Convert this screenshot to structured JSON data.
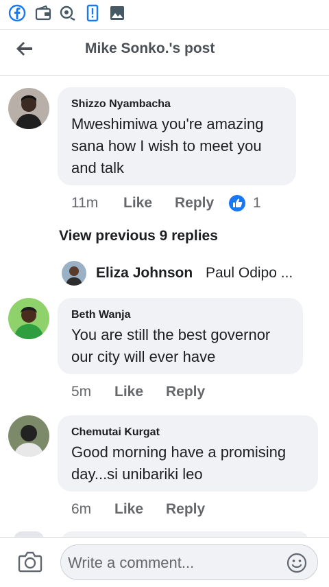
{
  "header": {
    "title": "Mike Sonko.'s post"
  },
  "comments": [
    {
      "author": "Shizzo Nyambacha",
      "lines": [
        "Mweshimiwa you're amazing",
        "sana how I wish to meet you",
        "and talk"
      ],
      "time": "11m",
      "like_label": "Like",
      "reply_label": "Reply",
      "reaction_count": "1"
    },
    {
      "author": "Beth Wanja",
      "lines": [
        "You are still the best governor",
        "our city will ever have"
      ],
      "time": "5m",
      "like_label": "Like",
      "reply_label": "Reply"
    },
    {
      "author": "Chemutai Kurgat",
      "lines": [
        "Good morning have a promising",
        "day...si unibariki leo"
      ],
      "time": "6m",
      "like_label": "Like",
      "reply_label": "Reply"
    }
  ],
  "view_previous": "View previous 9 replies",
  "reply_preview": {
    "author": "Eliza Johnson",
    "snippet": "Paul Odipo ..."
  },
  "composer": {
    "placeholder": "Write a comment..."
  },
  "statusbar_icons": [
    "facebook-icon",
    "wallet-icon",
    "location-icon",
    "sim-alert-icon",
    "gallery-icon"
  ],
  "colors": {
    "brand_blue": "#1877f2",
    "bubble": "#f0f2f5",
    "secondary_text": "#65676b"
  }
}
